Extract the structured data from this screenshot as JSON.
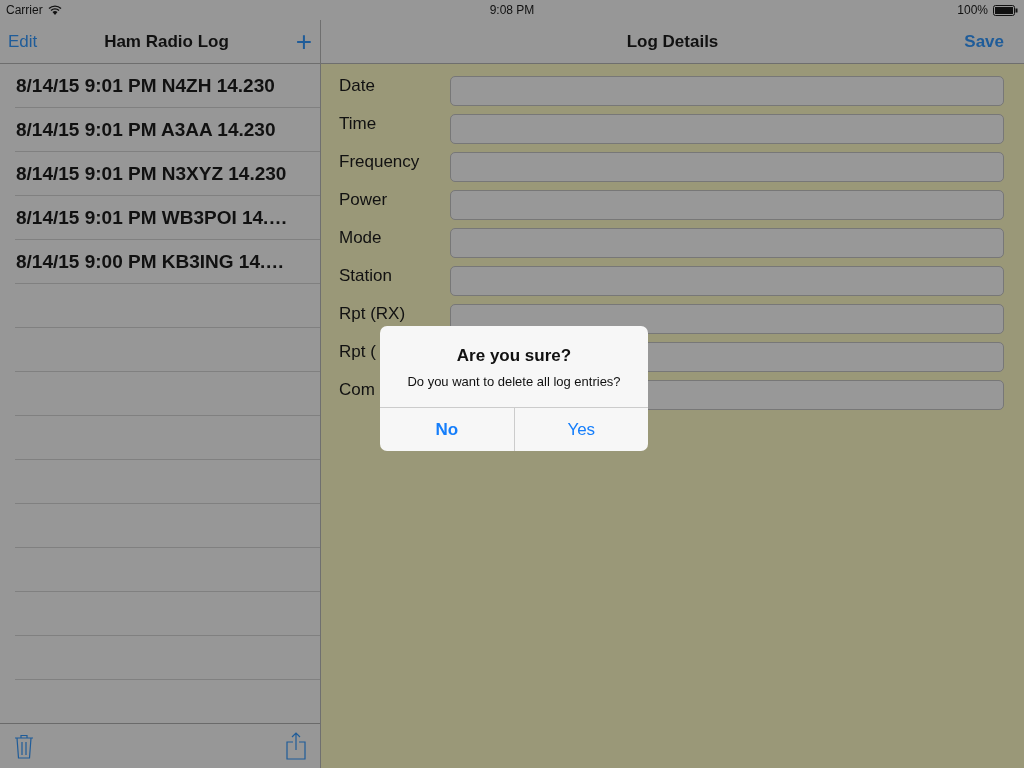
{
  "status_bar": {
    "carrier": "Carrier",
    "time": "9:08 PM",
    "battery": "100%"
  },
  "master": {
    "edit": "Edit",
    "title": "Ham Radio Log",
    "add": "+",
    "entries": [
      {
        "text": "8/14/15 9:01 PM N4ZH 14.230"
      },
      {
        "text": "8/14/15 9:01 PM A3AA 14.230"
      },
      {
        "text": "8/14/15 9:01 PM N3XYZ 14.230"
      },
      {
        "text": "8/14/15 9:01 PM WB3POI 14.…"
      },
      {
        "text": "8/14/15 9:00 PM KB3ING 14.…"
      }
    ]
  },
  "detail": {
    "title": "Log Details",
    "save": "Save",
    "fields": [
      {
        "label": "Date"
      },
      {
        "label": "Time"
      },
      {
        "label": "Frequency"
      },
      {
        "label": "Power"
      },
      {
        "label": "Mode"
      },
      {
        "label": "Station"
      },
      {
        "label": "Rpt (RX)"
      },
      {
        "label": "Rpt ("
      },
      {
        "label": "Com"
      }
    ]
  },
  "alert": {
    "title": "Are you sure?",
    "message": "Do you want to delete all log entries?",
    "buttons": [
      {
        "label": "No",
        "kind": "cancel"
      },
      {
        "label": "Yes",
        "kind": "default"
      }
    ]
  }
}
